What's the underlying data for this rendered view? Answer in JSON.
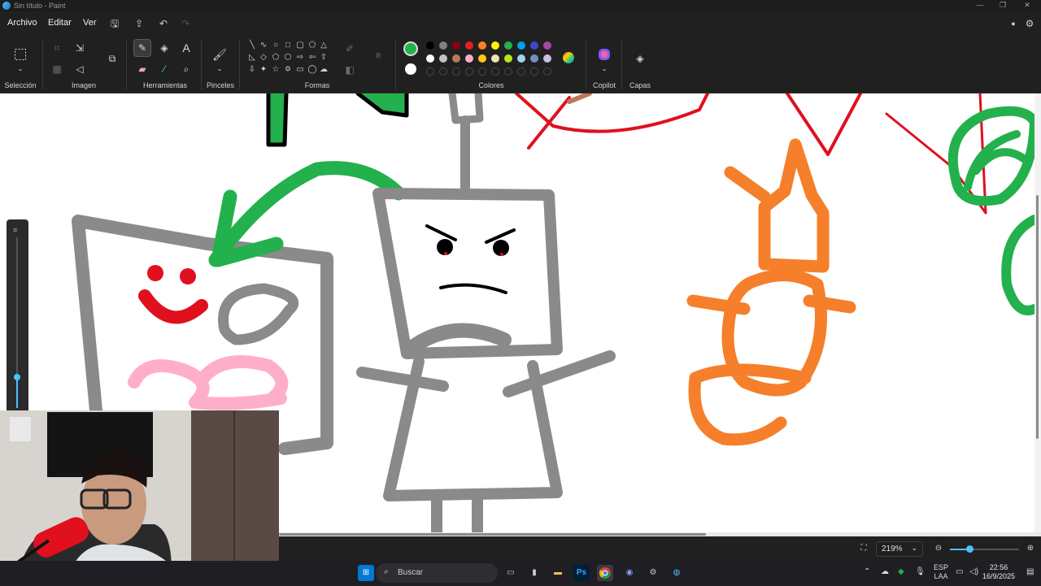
{
  "window": {
    "title": "Sin título - Paint"
  },
  "menu": {
    "file": "Archivo",
    "edit": "Editar",
    "view": "Ver"
  },
  "ribbon": {
    "groups": {
      "selection": "Selección",
      "image": "Imagen",
      "tools": "Herramientas",
      "brushes": "Pinceles",
      "shapes": "Formas",
      "colors": "Colores",
      "copilot": "Copilot",
      "layers": "Capas"
    },
    "active_tool": "pencil-icon",
    "primary_color": "#22b14c",
    "secondary_color": "#ffffff",
    "palette_row1": [
      "#000000",
      "#7f7f7f",
      "#880015",
      "#ed1c24",
      "#ff7f27",
      "#fff200",
      "#22b14c",
      "#00a2e8",
      "#3f48cc",
      "#a349a4"
    ],
    "palette_row2": [
      "#ffffff",
      "#c3c3c3",
      "#b97a57",
      "#ffaec9",
      "#ffc90e",
      "#efe4b0",
      "#b5e61d",
      "#99d9ea",
      "#7092be",
      "#c8bfe7"
    ]
  },
  "status": {
    "zoom": "219%"
  },
  "taskbar": {
    "search_placeholder": "Buscar",
    "language": "ESP",
    "language_sub": "LAA",
    "time": "22:56",
    "date": "16/9/2025"
  }
}
